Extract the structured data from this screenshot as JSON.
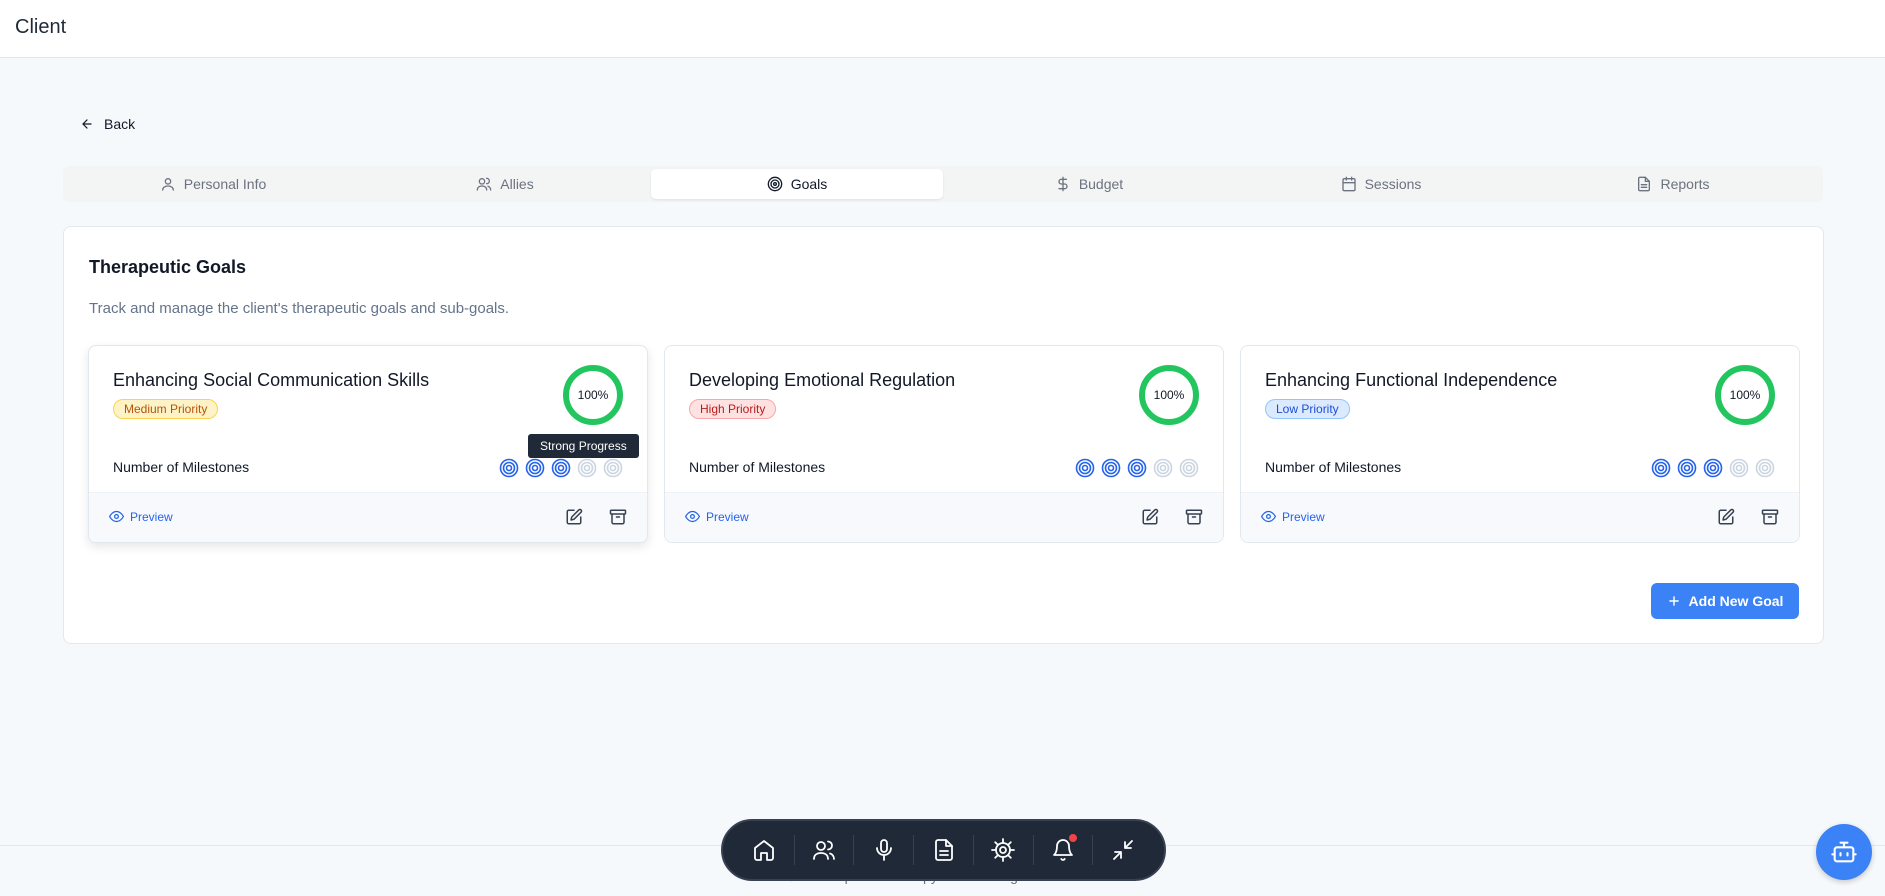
{
  "header": {
    "title": "Client"
  },
  "nav": {
    "back_label": "Back"
  },
  "tabs": [
    {
      "label": "Personal Info",
      "icon": "user-icon"
    },
    {
      "label": "Allies",
      "icon": "users-icon"
    },
    {
      "label": "Goals",
      "icon": "target-icon",
      "active": true
    },
    {
      "label": "Budget",
      "icon": "dollar-icon"
    },
    {
      "label": "Sessions",
      "icon": "calendar-icon"
    },
    {
      "label": "Reports",
      "icon": "file-icon"
    }
  ],
  "panel": {
    "title": "Therapeutic Goals",
    "subtitle": "Track and manage the client's therapeutic goals and sub-goals.",
    "milestones_label": "Number of Milestones",
    "preview_label": "Preview",
    "add_button": "Add New Goal"
  },
  "goals": [
    {
      "title": "Enhancing Social Communication Skills",
      "priority": "Medium Priority",
      "progress": "100%",
      "milestones_done": 3,
      "milestones_total": 5
    },
    {
      "title": "Developing Emotional Regulation",
      "priority": "High Priority",
      "progress": "100%",
      "milestones_done": 3,
      "milestones_total": 5
    },
    {
      "title": "Enhancing Functional Independence",
      "priority": "Low Priority",
      "progress": "100%",
      "milestones_done": 3,
      "milestones_total": 5
    }
  ],
  "tooltip": {
    "text": "Strong Progress"
  },
  "footer": {
    "text": "© 2025 Speech Therapy Clinic. All rights reserved."
  },
  "dock": [
    "home-icon",
    "users-icon",
    "microphone-icon",
    "document-icon",
    "settings-icon",
    "bell-icon",
    "minimize-icon"
  ],
  "colors": {
    "accent": "#3b82f6",
    "success": "#22c55e",
    "dock_bg": "#1f2937",
    "notification": "#ef4444"
  }
}
